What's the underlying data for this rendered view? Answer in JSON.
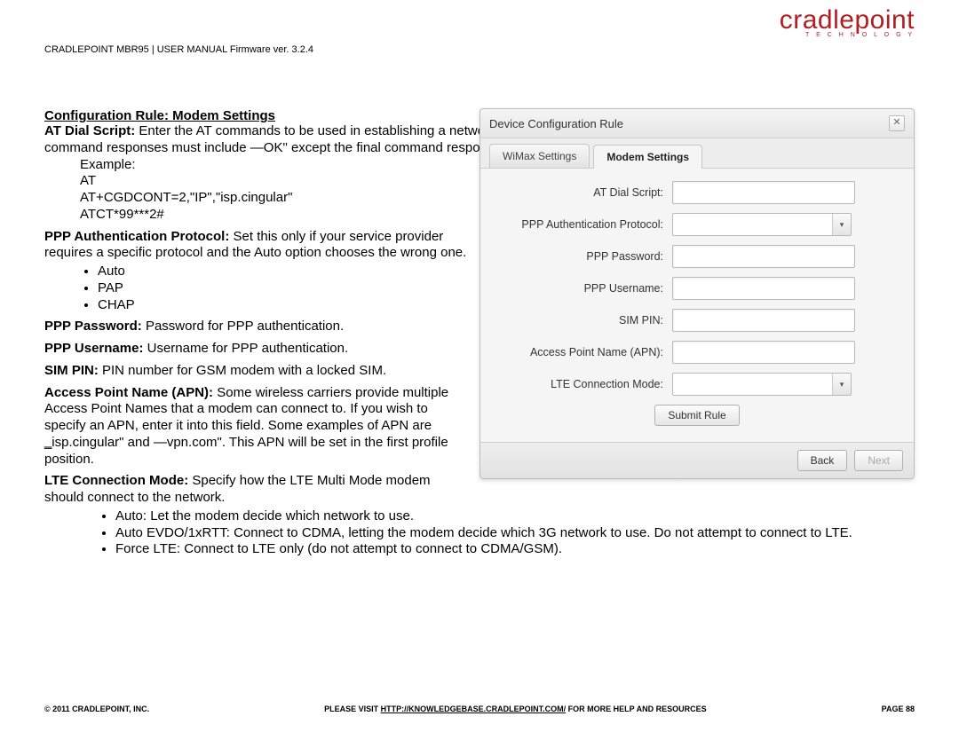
{
  "logo": {
    "main": "cradlepoint",
    "sub": "T E C H N O L O G Y"
  },
  "header": "CRADLEPOINT MBR95 | USER MANUAL Firmware ver. 3.2.4",
  "section_title": "Configuration Rule: Modem Settings",
  "p1_label": "AT Dial Script:",
  "p1_text": " Enter the AT commands to be used in establishing a network connection. Each command must be entered on a separate line. All command responses must include ―OK\" except the final command response, which must include ―CONECT\".",
  "example_lead": "Example:",
  "example_lines": [
    "AT",
    "AT+CGDCONT=2,\"IP\",\"isp.cingular\"",
    "ATCT*99***2#"
  ],
  "p2_label": "PPP Authentication Protocol:",
  "p2_text": " Set this only if your service provider requires a specific protocol and the Auto option chooses the wrong one.",
  "p2_list": [
    "Auto",
    "PAP",
    "CHAP"
  ],
  "p3_label": "PPP Password:",
  "p3_text": " Password for PPP authentication.",
  "p4_label": "PPP Username:",
  "p4_text": " Username for PPP authentication.",
  "p5_label": "SIM PIN:",
  "p5_text": " PIN number for GSM modem with a locked SIM.",
  "p6_label": "Access Point Name (APN):",
  "p6_text": " Some wireless carriers provide multiple Access Point Names that a modem can connect to. If you wish to specify an APN, enter it into this field. Some examples of APN are ‗isp.cingular\" and ―vpn.com\". This APN will be set in the first profile position.",
  "p7_label": "LTE Connection Mode:",
  "p7_text": " Specify how the LTE Multi Mode modem should connect to the network.",
  "p7_list": [
    "Auto: Let the modem decide which network to use.",
    "Auto EVDO/1xRTT: Connect to CDMA, letting the modem decide which 3G network to use. Do not attempt to connect to LTE.",
    "Force LTE: Connect to LTE only (do not attempt to connect to CDMA/GSM)."
  ],
  "dialog": {
    "title": "Device Configuration Rule",
    "tabs": [
      "WiMax Settings",
      "Modem Settings"
    ],
    "fields": {
      "at_dial": "AT Dial Script:",
      "ppp_auth": "PPP Authentication Protocol:",
      "ppp_pass": "PPP Password:",
      "ppp_user": "PPP Username:",
      "sim_pin": "SIM PIN:",
      "apn": "Access Point Name (APN):",
      "lte": "LTE Connection Mode:"
    },
    "submit": "Submit Rule",
    "back": "Back",
    "next": "Next"
  },
  "footer": {
    "left": "© 2011 CRADLEPOINT, INC.",
    "mid_pre": "PLEASE VISIT ",
    "link": "HTTP://KNOWLEDGEBASE.CRADLEPOINT.COM/",
    "mid_post": " FOR MORE HELP AND RESOURCES",
    "right": "PAGE 88"
  }
}
